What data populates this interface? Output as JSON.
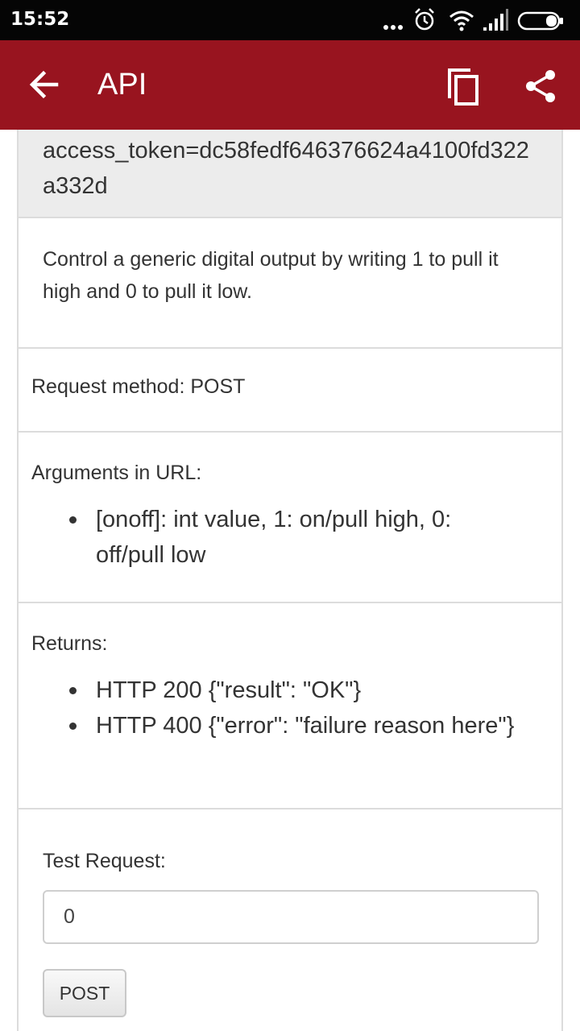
{
  "status_bar": {
    "time": "15:52",
    "icons": [
      "more-dots-icon",
      "alarm-icon",
      "wifi-icon",
      "signal-icon",
      "battery-icon"
    ]
  },
  "app_bar": {
    "title": "API",
    "background_color": "#98141f",
    "icons": [
      "arrow-left-icon",
      "copy-icon",
      "share-icon"
    ]
  },
  "endpoint": {
    "text": "access_token=dc58fedf646376624a4100fd322a332d"
  },
  "description": "Control a generic digital output by writing 1 to pull it high and 0 to pull it low.",
  "request_method": "Request method: POST",
  "arguments": {
    "heading": "Arguments in URL:",
    "items": [
      "[onoff]: int value, 1: on/pull high, 0: off/pull low"
    ]
  },
  "returns": {
    "heading": "Returns:",
    "items": [
      "HTTP 200 {\"result\": \"OK\"}",
      "HTTP 400 {\"error\": \"failure reason here\"}"
    ]
  },
  "test_request": {
    "label": "Test Request:",
    "input_value": "0",
    "button_label": "POST"
  }
}
